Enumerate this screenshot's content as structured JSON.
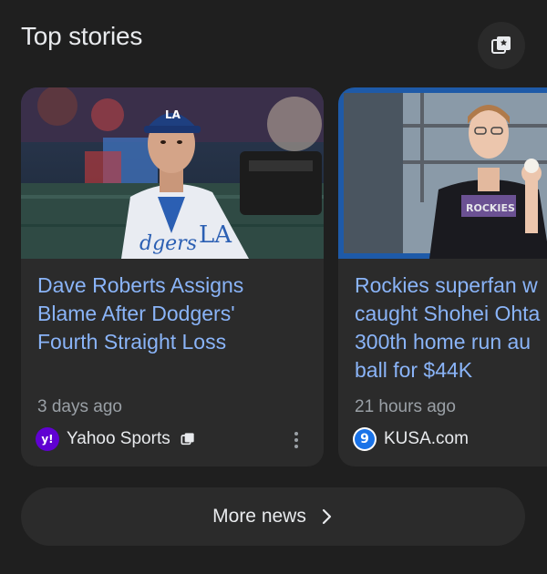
{
  "section": {
    "title": "Top stories",
    "header_icon": "news-showcase-icon"
  },
  "stories": [
    {
      "headline": "Dave Roberts Assigns\nBlame After Dodgers'\nFourth Straight Loss",
      "time": "3 days ago",
      "source": "Yahoo Sports",
      "source_logo_letter": "y!",
      "source_logo_color": "#6001d2",
      "source_icon": "news-showcase-icon",
      "thumbnail": "dodgers-player-dugout-photo"
    },
    {
      "headline": "Rockies superfan w\ncaught Shohei Ohta\n300th home run au\nball for $44K",
      "time": "21 hours ago",
      "source": "KUSA.com",
      "source_logo_letter": "9",
      "source_logo_color": "#1a73e8",
      "thumbnail": "rockies-fan-with-ball-photo"
    }
  ],
  "footer": {
    "more_label": "More news",
    "more_icon": "chevron-right-icon"
  },
  "colors": {
    "background": "#1f1f1f",
    "card": "#2b2b2b",
    "headline": "#8ab4f8",
    "meta": "#9aa0a6",
    "text": "#e8eaed"
  }
}
